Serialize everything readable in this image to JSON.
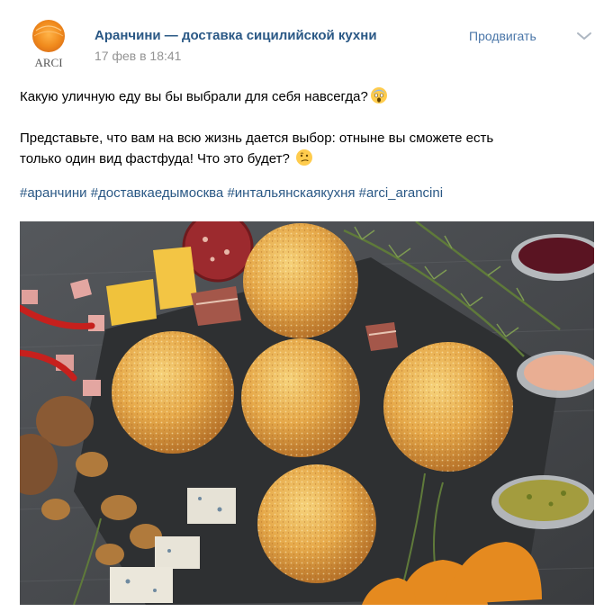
{
  "post": {
    "author": "Аранчини — доставка сицилийской кухни",
    "date": "17 фев в 18:41",
    "promote_label": "Продвигать",
    "logo_text": "ARCI",
    "text_line1": "Какую уличную еду вы бы выбрали для себя навсегда?",
    "text_line2": "Представьте, что вам на всю жизнь дается выбор: отныне вы сможете есть",
    "text_line3": "только один вид фастфуда! Что это будет?",
    "hashtags": [
      "#аранчини",
      "#доставкаедымосква",
      "#интальянскаякухня",
      "#arci_arancini"
    ]
  },
  "icons": {
    "emoji_1": "scream-emoji-icon",
    "emoji_2": "thinking-emoji-icon",
    "menu": "chevron-down-icon"
  },
  "colors": {
    "link": "#2a5885",
    "accent": "#4a76a8",
    "meta": "#939393",
    "logo_orange": "#f08a1c"
  }
}
